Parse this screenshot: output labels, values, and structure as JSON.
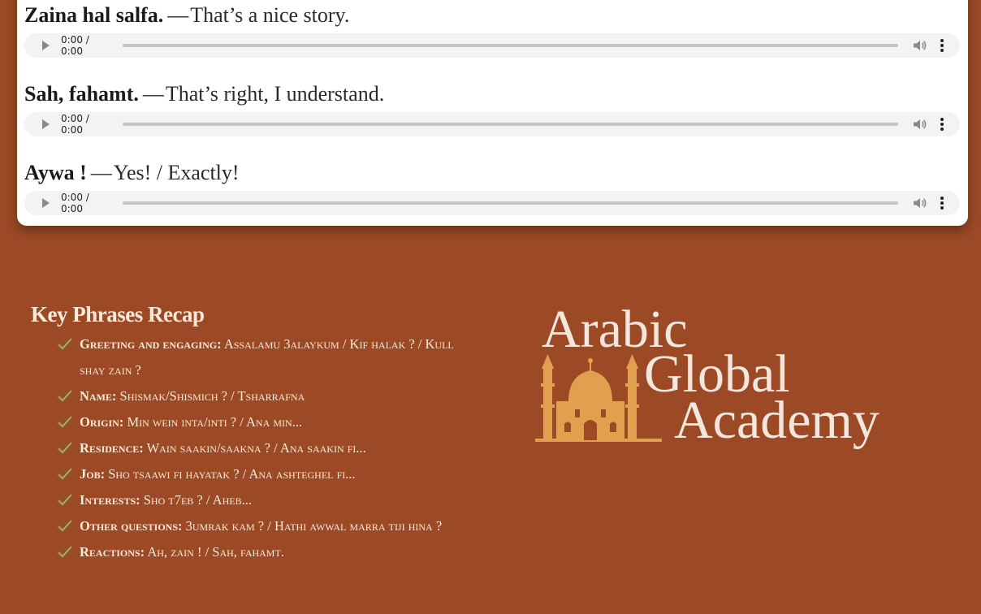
{
  "dialogue": [
    {
      "arabic": "Zaina hal salfa.",
      "english": "That’s a nice story."
    },
    {
      "arabic": "Sah, fahamt.",
      "english": "That’s right, I understand."
    },
    {
      "arabic": "Aywa !",
      "english": "Yes! / Exactly!"
    }
  ],
  "separator": "—",
  "audio_time": "0:00 / 0:00",
  "recap": {
    "title": "Key Phrases Recap",
    "items": [
      {
        "label": "Greeting and engaging:",
        "text": "Assalamu 3alaykum / Kif halak ? / Kull shay zain ?"
      },
      {
        "label": "Name:",
        "text": "Shismak/Shismich ? / Tsharrafna"
      },
      {
        "label": "Origin:",
        "text": "Min wein inta/inti ? / Ana min..."
      },
      {
        "label": "Residence:",
        "text": "Wain saakin/saakna ? / Ana saakin fi..."
      },
      {
        "label": "Job:",
        "text": "Sho tsaawi fi hayatak ? / Ana ashteghel fi..."
      },
      {
        "label": "Interests:",
        "text": "Sho t7eb ? / Aheb..."
      },
      {
        "label": "Other questions:",
        "text": "3umrak kam ? / Hathi awwal marra tiji hina ?"
      },
      {
        "label": "Reactions:",
        "text": "Ah, zain ! / Sah, fahamt."
      }
    ]
  },
  "logo": {
    "line1": "Arabic",
    "line2": "Global",
    "line3": "Academy"
  },
  "colors": {
    "background": "#9b4a25",
    "card": "#ffffff",
    "recap_text": "#fbe9d9",
    "check": "#8db57a",
    "logo_mosque": "#e0a04e",
    "logo_text": "#f4e6dc"
  },
  "icons": {
    "play": "play-icon",
    "volume": "volume-icon",
    "menu": "more-vert-icon",
    "check": "check-icon"
  }
}
